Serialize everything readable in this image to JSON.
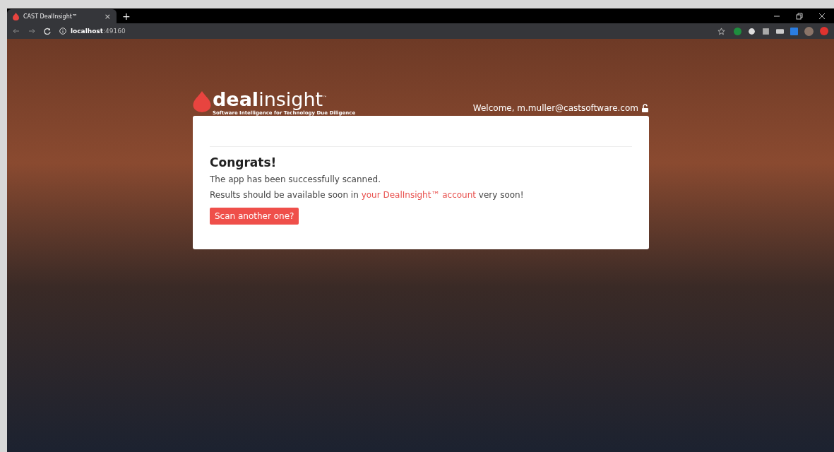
{
  "browser": {
    "tab": {
      "title": "CAST DealInsight™",
      "close": "×",
      "selected": true
    },
    "new_tab": "+",
    "address": "**localhost**:49160"
  },
  "header": {
    "logo": "**deal**insight$^{™}$",
    "tagline": "Software Intelligence for Technology Due Diligence",
    "welcome": "Welcome, m.muller@castsoftware.com"
  },
  "card": {
    "heading": "Congrats!",
    "message": "The app has been successfully scanned.",
    "result_before": "Results should be available soon in ",
    "result_link": "your DealInsight™ account",
    "result_after": " very soon!",
    "button": "Scan another one?"
  }
}
